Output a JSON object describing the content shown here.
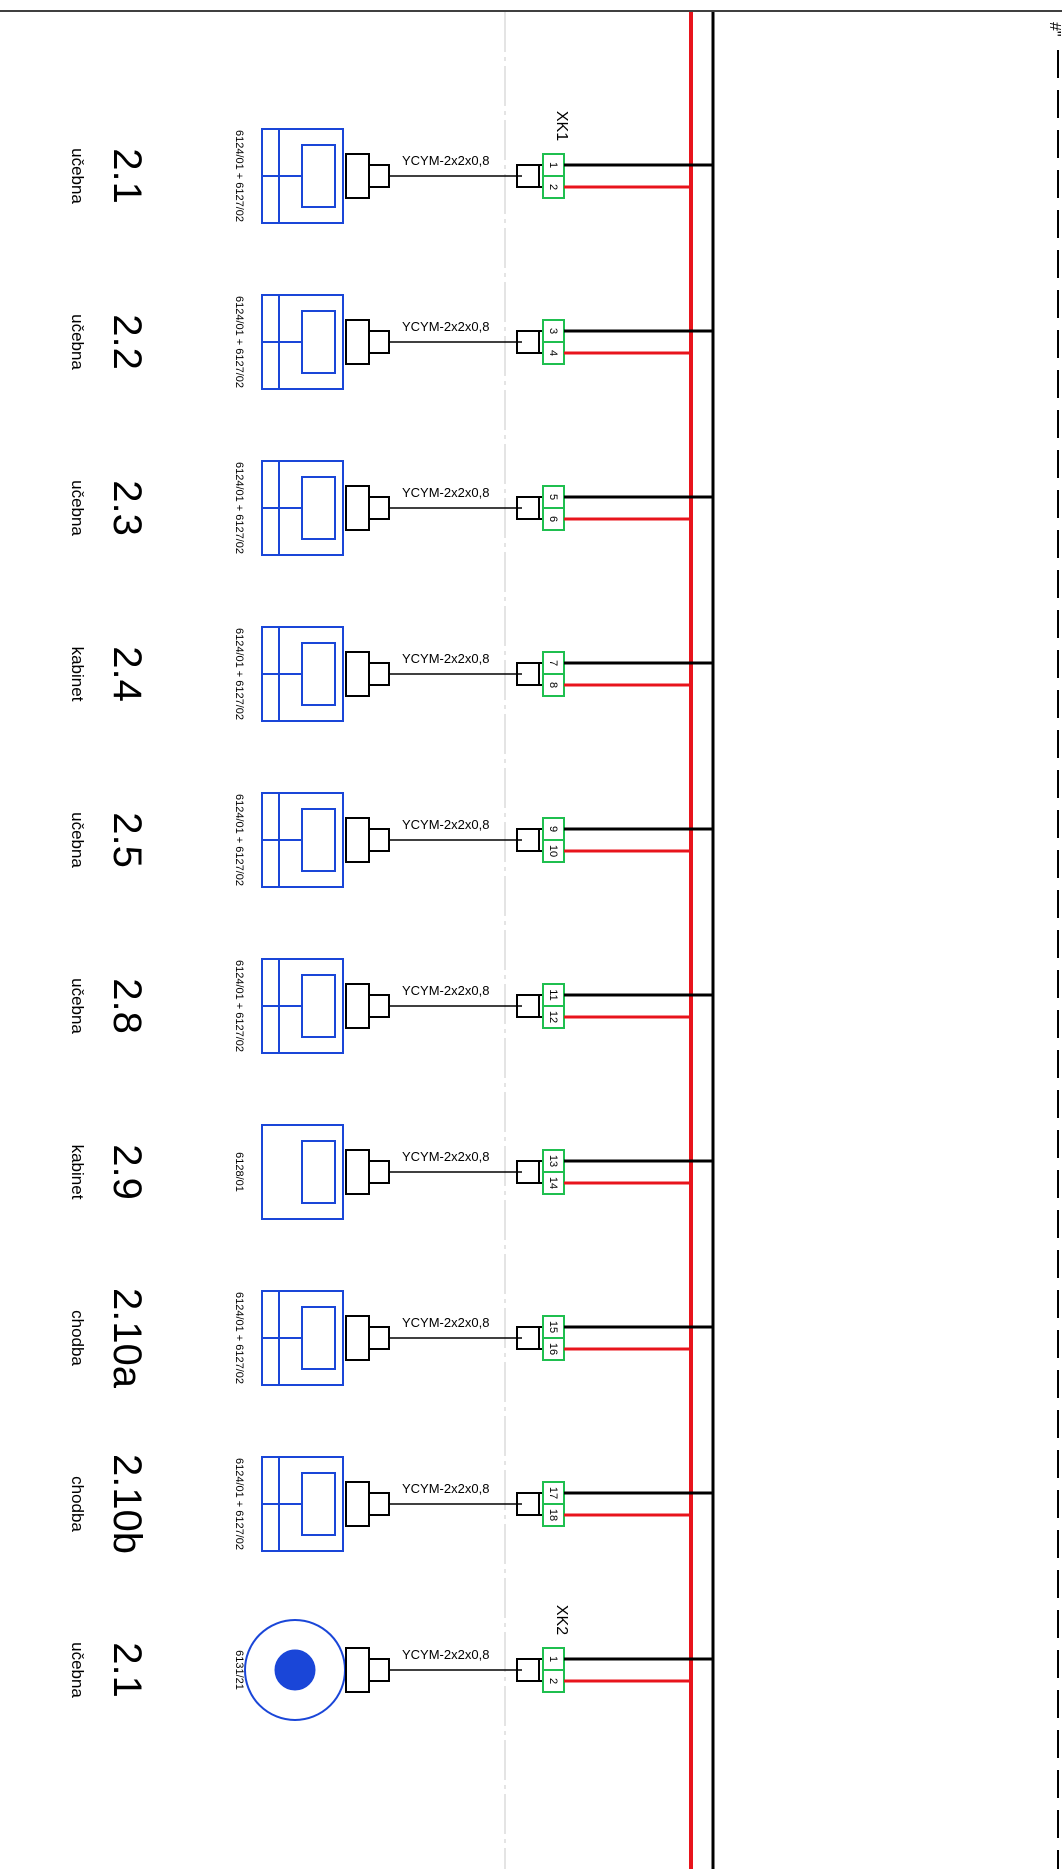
{
  "diagram": {
    "colors": {
      "bus_red": "#e8141c",
      "bus_black": "#000000",
      "device_blue": "#1a46d8",
      "terminal_green": "#1fbf4f",
      "frame_black": "#000000",
      "guide_gray": "#c8c8c8"
    },
    "terminal_strips": [
      {
        "label": "XK1"
      },
      {
        "label": "XK2"
      }
    ],
    "corner_mark": "#\"",
    "rows": [
      {
        "room": "2.1",
        "type": "učebna",
        "device": "6124/01 + 6127/02",
        "device_kind": "panel-double",
        "cable": "YCYM-2x2x0,8",
        "term_a": "1",
        "term_b": "2",
        "strip_label": "XK1"
      },
      {
        "room": "2.2",
        "type": "učebna",
        "device": "6124/01 + 6127/02",
        "device_kind": "panel-double",
        "cable": "YCYM-2x2x0,8",
        "term_a": "3",
        "term_b": "4",
        "strip_label": ""
      },
      {
        "room": "2.3",
        "type": "učebna",
        "device": "6124/01 + 6127/02",
        "device_kind": "panel-double",
        "cable": "YCYM-2x2x0,8",
        "term_a": "5",
        "term_b": "6",
        "strip_label": ""
      },
      {
        "room": "2.4",
        "type": "kabinet",
        "device": "6124/01 + 6127/02",
        "device_kind": "panel-double",
        "cable": "YCYM-2x2x0,8",
        "term_a": "7",
        "term_b": "8",
        "strip_label": ""
      },
      {
        "room": "2.5",
        "type": "učebna",
        "device": "6124/01 + 6127/02",
        "device_kind": "panel-double",
        "cable": "YCYM-2x2x0,8",
        "term_a": "9",
        "term_b": "10",
        "strip_label": ""
      },
      {
        "room": "2.8",
        "type": "učebna",
        "device": "6124/01 + 6127/02",
        "device_kind": "panel-double",
        "cable": "YCYM-2x2x0,8",
        "term_a": "11",
        "term_b": "12",
        "strip_label": ""
      },
      {
        "room": "2.9",
        "type": "kabinet",
        "device": "6128/01",
        "device_kind": "panel-single",
        "cable": "YCYM-2x2x0,8",
        "term_a": "13",
        "term_b": "14",
        "strip_label": ""
      },
      {
        "room": "2.10a",
        "type": "chodba",
        "device": "6124/01 + 6127/02",
        "device_kind": "panel-double",
        "cable": "YCYM-2x2x0,8",
        "term_a": "15",
        "term_b": "16",
        "strip_label": ""
      },
      {
        "room": "2.10b",
        "type": "chodba",
        "device": "6124/01 + 6127/02",
        "device_kind": "panel-double",
        "cable": "YCYM-2x2x0,8",
        "term_a": "17",
        "term_b": "18",
        "strip_label": ""
      },
      {
        "room": "2.1",
        "type": "učebna",
        "device": "6131/21",
        "device_kind": "round",
        "cable": "YCYM-2x2x0,8",
        "term_a": "1",
        "term_b": "2",
        "strip_label": "XK2"
      }
    ]
  }
}
